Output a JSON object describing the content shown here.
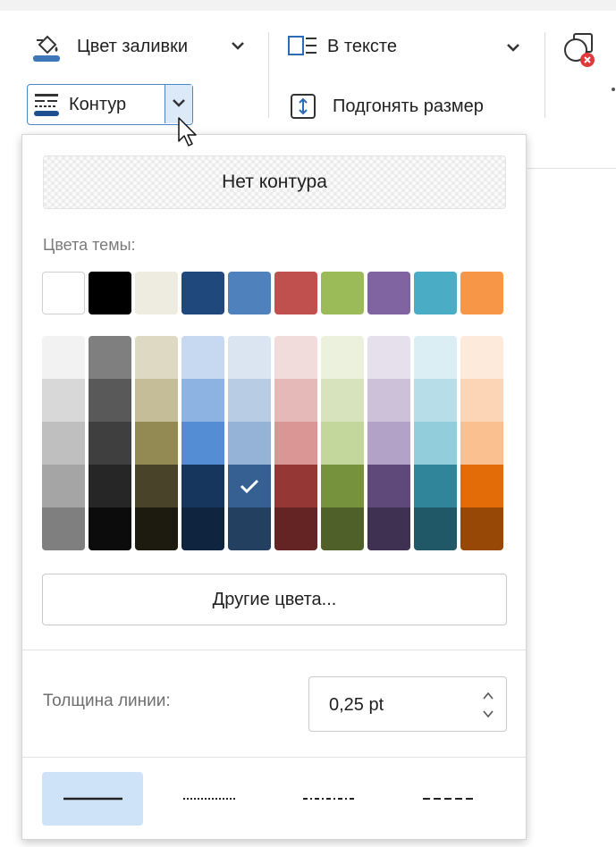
{
  "toolbar": {
    "fill_color_label": "Цвет заливки",
    "contour_label": "Контур",
    "in_text_label": "В тексте",
    "fit_size_label": "Подгонять размер"
  },
  "panel": {
    "no_contour_label": "Нет контура",
    "theme_colors_label": "Цвета темы:",
    "theme_colors": [
      "#ffffff",
      "#000000",
      "#eeece1",
      "#1f497d",
      "#4f81bd",
      "#c0504d",
      "#9bbb59",
      "#8064a2",
      "#4bacc6",
      "#f79646"
    ],
    "shades": [
      [
        "#f2f2f2",
        "#d8d8d8",
        "#bfbfbf",
        "#a5a5a5",
        "#7f7f7f"
      ],
      [
        "#7f7f7f",
        "#595959",
        "#3f3f3f",
        "#262626",
        "#0c0c0c"
      ],
      [
        "#ddd9c3",
        "#c4bd97",
        "#938953",
        "#494429",
        "#1d1b10"
      ],
      [
        "#c6d9f0",
        "#8db3e2",
        "#548dd4",
        "#17365d",
        "#0f243e"
      ],
      [
        "#dbe5f1",
        "#b8cce4",
        "#95b3d7",
        "#366092",
        "#244061"
      ],
      [
        "#f2dcdb",
        "#e5b9b7",
        "#d99694",
        "#953734",
        "#632423"
      ],
      [
        "#ebf1dd",
        "#d7e3bc",
        "#c3d69b",
        "#76923c",
        "#4f6128"
      ],
      [
        "#e5e0ec",
        "#ccc1d9",
        "#b2a2c7",
        "#5f497a",
        "#3f3151"
      ],
      [
        "#dbeef3",
        "#b7dde8",
        "#92cddc",
        "#31859b",
        "#205867"
      ],
      [
        "#fdeada",
        "#fbd5b5",
        "#fac08f",
        "#e36c09",
        "#974806"
      ]
    ],
    "selected_shade": {
      "col": 4,
      "row": 3
    },
    "other_colors_label": "Другие цвета...",
    "line_thickness_label": "Толщина линии:",
    "line_thickness_value": "0,25 pt",
    "line_styles": [
      "solid-line-icon",
      "dotted-line-icon",
      "dash-dot-line-icon",
      "dashed-line-icon"
    ],
    "selected_style_index": 0
  },
  "colors": {
    "accent": "#4a86c8",
    "selected_style_bg": "#cfe3f8"
  }
}
